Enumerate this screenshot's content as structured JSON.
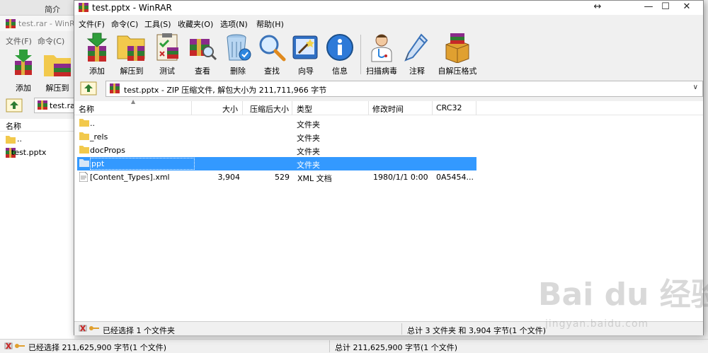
{
  "background_window": {
    "tab_label": "简介",
    "title": "test.rar - WinR",
    "menu": [
      "文件(F)",
      "命令(C)"
    ],
    "toolbar": [
      "添加",
      "解压到"
    ],
    "address": "test.ra",
    "list_header": "名称",
    "rows": [
      "..",
      " test.pptx"
    ],
    "status_left": "已经选择 211,625,900 字节(1 个文件)",
    "status_right": "总计 211,625,900 字节(1 个文件)"
  },
  "window": {
    "title": "test.pptx - WinRAR",
    "controls": {
      "resize": "↔",
      "minimize": "—",
      "maximize": "☐",
      "close": "✕"
    }
  },
  "menu": [
    "文件(F)",
    "命令(C)",
    "工具(S)",
    "收藏夹(O)",
    "选项(N)",
    "帮助(H)"
  ],
  "toolbar": [
    {
      "label": "添加",
      "icon": "add-books-icon"
    },
    {
      "label": "解压到",
      "icon": "extract-folder-icon"
    },
    {
      "label": "测试",
      "icon": "test-clipboard-icon"
    },
    {
      "label": "查看",
      "icon": "view-books-icon"
    },
    {
      "label": "删除",
      "icon": "delete-trash-icon"
    },
    {
      "label": "查找",
      "icon": "find-magnifier-icon"
    },
    {
      "label": "向导",
      "icon": "wizard-wand-icon"
    },
    {
      "label": "信息",
      "icon": "info-icon"
    },
    {
      "label": "扫描病毒",
      "icon": "scan-virus-doctor-icon"
    },
    {
      "label": "注释",
      "icon": "comment-pen-icon"
    },
    {
      "label": "自解压格式",
      "icon": "sfx-box-icon"
    }
  ],
  "address": "test.pptx - ZIP 压缩文件, 解包大小为 211,711,966 字节",
  "columns": {
    "name": "名称",
    "size": "大小",
    "packed": "压缩后大小",
    "type": "类型",
    "modified": "修改时间",
    "crc": "CRC32"
  },
  "files": [
    {
      "name": "..",
      "size": "",
      "packed": "",
      "type": "文件夹",
      "modified": "",
      "crc": "",
      "icon": "folder-icon"
    },
    {
      "name": "_rels",
      "size": "",
      "packed": "",
      "type": "文件夹",
      "modified": "",
      "crc": "",
      "icon": "folder-icon"
    },
    {
      "name": "docProps",
      "size": "",
      "packed": "",
      "type": "文件夹",
      "modified": "",
      "crc": "",
      "icon": "folder-icon"
    },
    {
      "name": "ppt",
      "size": "",
      "packed": "",
      "type": "文件夹",
      "modified": "",
      "crc": "",
      "icon": "folder-icon",
      "selected": true
    },
    {
      "name": "[Content_Types].xml",
      "size": "3,904",
      "packed": "529",
      "type": "XML 文档",
      "modified": "1980/1/1 0:00",
      "crc": "0A5454...",
      "icon": "xml-file-icon"
    }
  ],
  "status": {
    "left": "已经选择 1 个文件夹",
    "right": "总计 3 文件夹 和 3,904 字节(1 个文件)"
  },
  "watermark": {
    "logo": "Bai du 经验",
    "url": "jingyan.baidu.com"
  }
}
